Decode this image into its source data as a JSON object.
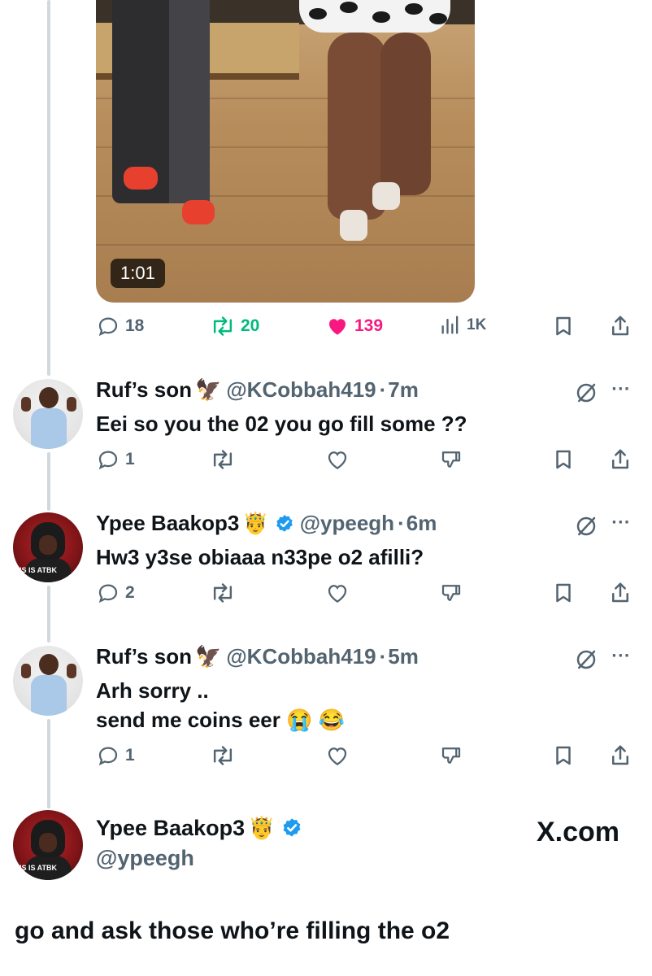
{
  "media": {
    "duration": "1:01"
  },
  "main_tweet_actions": {
    "replies": "18",
    "reposts": "20",
    "likes": "139",
    "views": "1K"
  },
  "replies": [
    {
      "name": "Ruf’s son",
      "handle": "@KCobbah419",
      "time": "7m",
      "emoji": "🦅",
      "verified": false,
      "lines": [
        "Eei so you the 02 you go fill some ??"
      ],
      "reply_count": "1"
    },
    {
      "name": "Ypee Baakop3",
      "handle": "@ypeegh",
      "time": "6m",
      "emoji": "🤴",
      "verified": true,
      "lines": [
        "Hw3 y3se obiaaa n33pe o2 afilli?"
      ],
      "reply_count": "2"
    },
    {
      "name": "Ruf’s son",
      "handle": "@KCobbah419",
      "time": "5m",
      "emoji": "🦅",
      "verified": false,
      "lines": [
        "Arh sorry ..",
        "send me coins eer 😭 😂"
      ],
      "reply_count": "1"
    }
  ],
  "final_post": {
    "name": "Ypee Baakop3",
    "emoji": "🤴",
    "verified": true,
    "handle": "@ypeegh",
    "site": "X.com",
    "text": "go and ask those who’re filling the o2"
  },
  "avatar_text": "US IS ATBK",
  "colors": {
    "like": "#f91880",
    "repost": "#00ba7c",
    "verified": "#1d9bf0",
    "muted": "#536471",
    "text": "#0f1419"
  }
}
